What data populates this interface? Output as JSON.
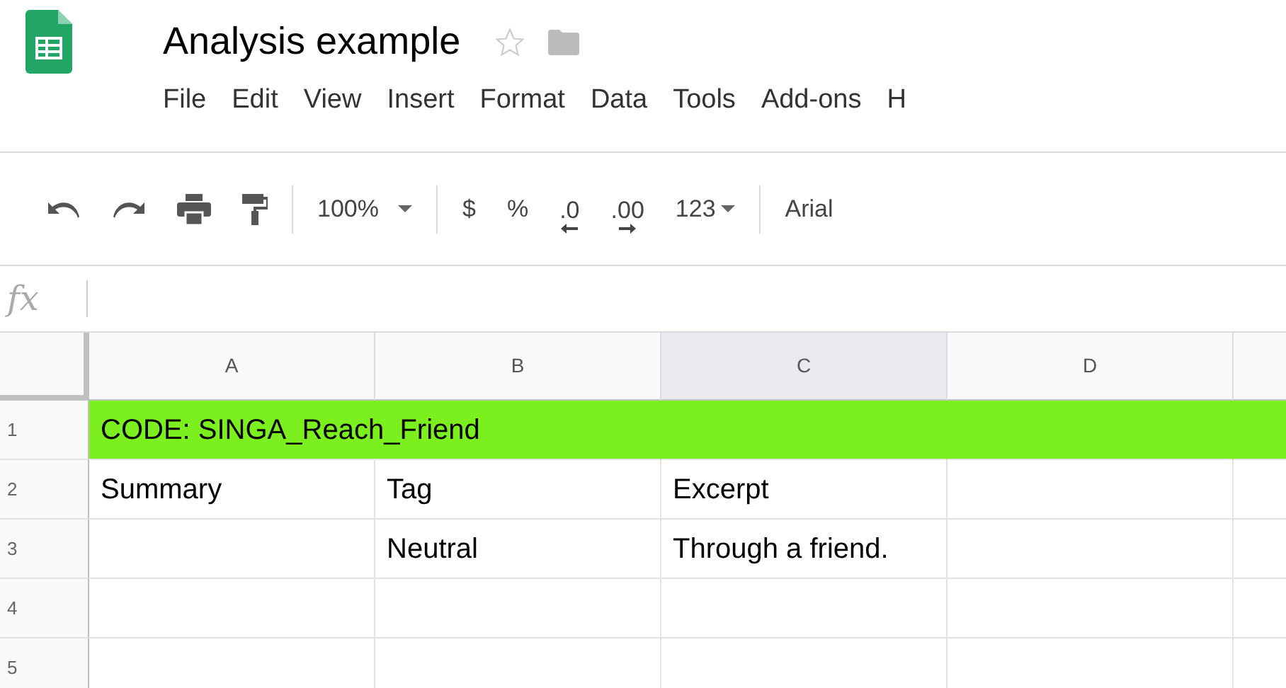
{
  "document": {
    "title": "Analysis example",
    "starred": false
  },
  "menu": [
    "File",
    "Edit",
    "View",
    "Insert",
    "Format",
    "Data",
    "Tools",
    "Add-ons",
    "H"
  ],
  "toolbar": [
    {
      "kind": "undo"
    },
    {
      "kind": "redo"
    },
    {
      "kind": "print"
    },
    {
      "kind": "paint"
    },
    {
      "kind": "sep"
    },
    {
      "kind": "dropdown",
      "label": "100%"
    },
    {
      "kind": "sep"
    },
    {
      "kind": "text",
      "label": "$"
    },
    {
      "kind": "text",
      "label": "%"
    },
    {
      "kind": "decimal-less",
      "label": ".0"
    },
    {
      "kind": "decimal-more",
      "label": ".00"
    },
    {
      "kind": "dropdown-tight",
      "label": "123"
    },
    {
      "kind": "sep"
    },
    {
      "kind": "text",
      "label": "Arial"
    }
  ],
  "formula_bar": {
    "label": "fx"
  },
  "columns": [
    {
      "label": "A",
      "selected": false
    },
    {
      "label": "B",
      "selected": false
    },
    {
      "label": "C",
      "selected": true
    },
    {
      "label": "D",
      "selected": false
    }
  ],
  "rows": [
    {
      "label": "1",
      "highlighted": true,
      "cells": [
        "CODE: SINGA_Reach_Friend",
        null,
        null,
        null
      ]
    },
    {
      "label": "2",
      "highlighted": false,
      "cells": [
        "Summary",
        "Tag",
        "Excerpt",
        null
      ]
    },
    {
      "label": "3",
      "highlighted": false,
      "cells": [
        null,
        "Neutral",
        "Through a friend.",
        null
      ]
    },
    {
      "label": "4",
      "highlighted": false,
      "cells": [
        null,
        null,
        null,
        null
      ]
    },
    {
      "label": "5",
      "highlighted": false,
      "cells": [
        null,
        null,
        null,
        null
      ]
    }
  ]
}
